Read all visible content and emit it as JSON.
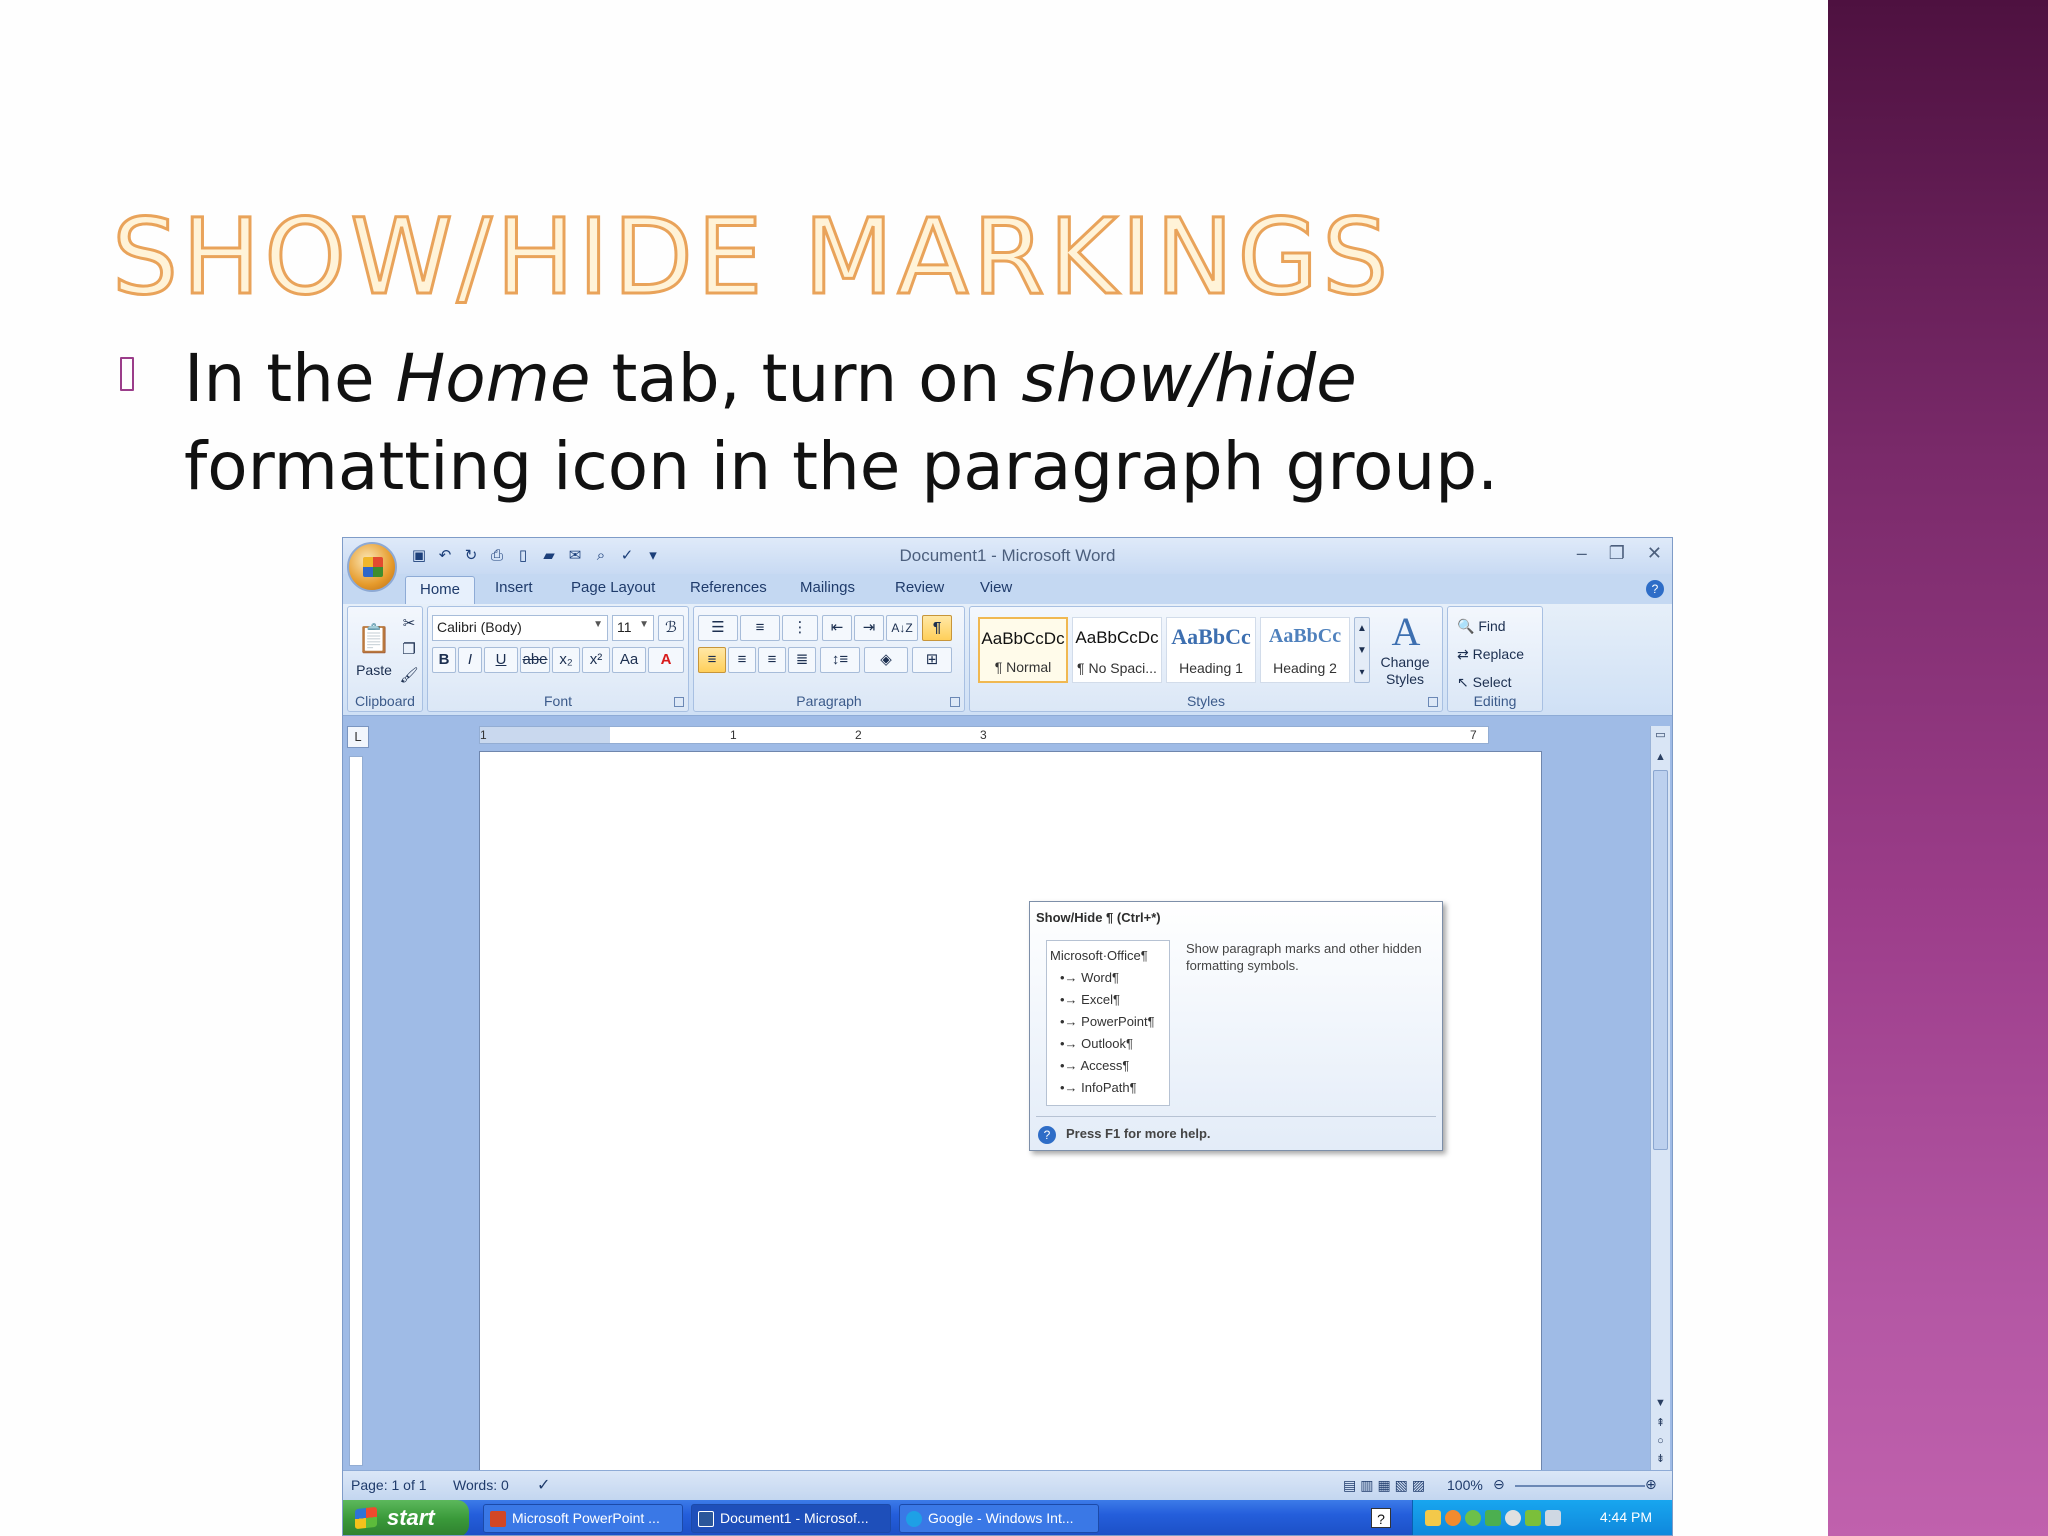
{
  "slide": {
    "title": "Show/Hide Markings",
    "bullet_parts": {
      "p1": "In the ",
      "home": "Home",
      "p2": " tab, turn on ",
      "showhide": "show/hide",
      "p3": " formatting icon in the paragraph group."
    },
    "accent_color": "#9d3e8b",
    "title_color": "#e9a35a"
  },
  "word": {
    "window_title": "Document1 - Microsoft Word",
    "controls": {
      "minimize": "–",
      "restore": "❐",
      "close": "✕"
    },
    "tabs": [
      "Home",
      "Insert",
      "Page Layout",
      "References",
      "Mailings",
      "Review",
      "View"
    ],
    "active_tab": "Home",
    "ribbon": {
      "clipboard": {
        "label": "Clipboard",
        "paste": "Paste"
      },
      "font": {
        "label": "Font",
        "font_name": "Calibri (Body)",
        "font_size": "11",
        "buttons": {
          "bold": "B",
          "italic": "I",
          "underline": "U",
          "strike": "abe",
          "subscript": "x₂",
          "superscript": "x²",
          "case": "Aa",
          "grow": "A",
          "shrink": "A"
        }
      },
      "paragraph": {
        "label": "Paragraph",
        "showhide_glyph": "¶",
        "sort_glyph": "A↓Z"
      },
      "styles": {
        "label": "Styles",
        "items": [
          {
            "sample": "AaBbCcDc",
            "name": "¶ Normal"
          },
          {
            "sample": "AaBbCcDc",
            "name": "¶ No Spaci..."
          },
          {
            "sample": "AaBbCc",
            "name": "Heading 1"
          },
          {
            "sample": "AaBbCc",
            "name": "Heading 2"
          }
        ],
        "change_styles": "Change Styles"
      },
      "editing": {
        "label": "Editing",
        "find": "Find",
        "replace": "Replace",
        "select": "Select"
      }
    },
    "ruler_numbers": [
      "1",
      "1",
      "2",
      "3",
      "7"
    ],
    "tooltip": {
      "title": "Show/Hide ¶ (Ctrl+*)",
      "preview_heading": "Microsoft·Office¶",
      "preview_items": [
        "Word¶",
        "Excel¶",
        "PowerPoint¶",
        "Outlook¶",
        "Access¶",
        "InfoPath¶"
      ],
      "description": "Show paragraph marks and other hidden formatting symbols.",
      "help": "Press F1 for more help."
    },
    "status": {
      "page": "Page: 1 of 1",
      "words": "Words: 0",
      "zoom": "100%"
    }
  },
  "taskbar": {
    "start": "start",
    "buttons": [
      {
        "label": "Microsoft PowerPoint ...",
        "active": false
      },
      {
        "label": "Document1 - Microsof...",
        "active": true
      },
      {
        "label": "Google - Windows Int...",
        "active": false
      }
    ],
    "clock": "4:44 PM",
    "help_glyph": "?"
  }
}
